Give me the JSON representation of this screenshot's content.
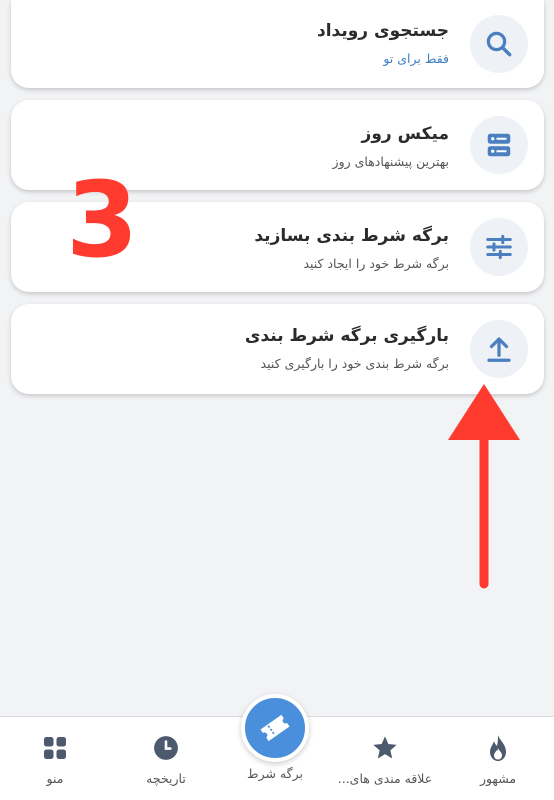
{
  "menu": [
    {
      "title": "جستجوی رویداد",
      "subtitle": "فقط برای تو",
      "icon": "search-icon"
    },
    {
      "title": "میکس روز",
      "subtitle": "بهترین پیشنهادهای روز",
      "icon": "server-icon"
    },
    {
      "title": "برگه شرط بندی بسازید",
      "subtitle": "برگه شرط خود را ایجاد کنید",
      "icon": "sliders-icon"
    },
    {
      "title": "بارگیری برگه شرط بندی",
      "subtitle": "برگه شرط بندی خود را بارگیری کنید",
      "icon": "upload-icon"
    }
  ],
  "annotation": {
    "number": "3",
    "color": "#ff3b30",
    "arrow": "up"
  },
  "nav": {
    "popular": "مشهور",
    "favorites": "علاقه مندی های...",
    "betslip": "برگه شرط",
    "history": "تاریخچه",
    "menu": "منو"
  },
  "colors": {
    "accent": "#4a8fdb",
    "icon": "#4a7fc0",
    "subtitle": "#3f7fc4",
    "background": "#f2f3f5"
  }
}
